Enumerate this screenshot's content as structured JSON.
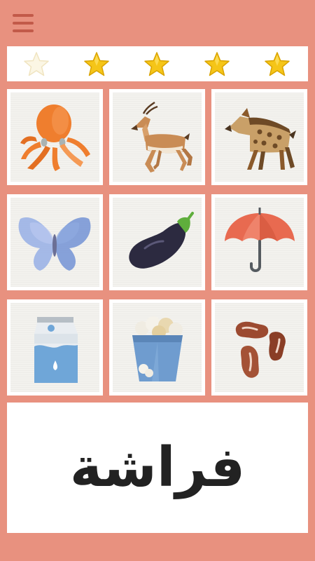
{
  "header": {
    "menu_icon": "hamburger-menu-icon"
  },
  "stars": {
    "total": 5,
    "earned": 4,
    "icon": "star-icon",
    "colors": {
      "earned": "#f5c518",
      "empty": "#fbf6e4"
    }
  },
  "grid": {
    "cards": [
      {
        "icon": "octopus-icon"
      },
      {
        "icon": "gazelle-icon"
      },
      {
        "icon": "hyena-icon"
      },
      {
        "icon": "butterfly-icon"
      },
      {
        "icon": "eggplant-icon"
      },
      {
        "icon": "umbrella-icon"
      },
      {
        "icon": "milk-carton-icon"
      },
      {
        "icon": "popcorn-icon"
      },
      {
        "icon": "beans-icon"
      }
    ]
  },
  "word_panel": {
    "word": "فراشة"
  },
  "colors": {
    "background": "#e8917f",
    "accent": "#c25a49"
  }
}
